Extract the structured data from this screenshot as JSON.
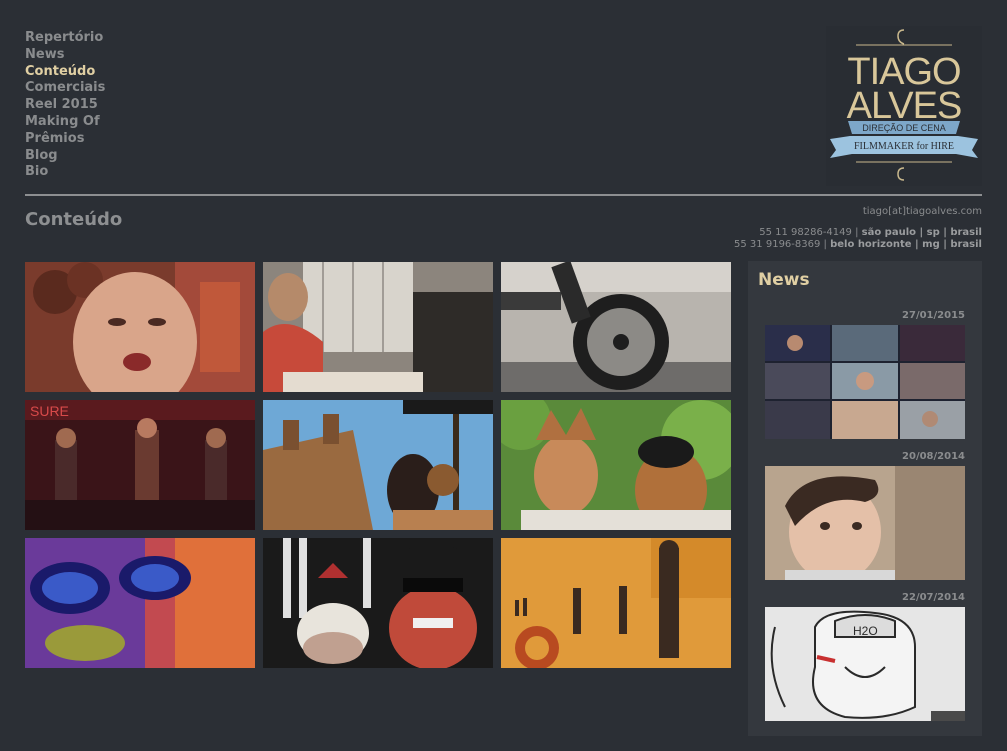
{
  "nav": {
    "items": [
      {
        "label": "Repertório",
        "active": false
      },
      {
        "label": "News",
        "active": false
      },
      {
        "label": "Conteúdo",
        "active": true
      },
      {
        "label": "Comerciais",
        "active": false
      },
      {
        "label": "Reel 2015",
        "active": false
      },
      {
        "label": "Making Of",
        "active": false
      },
      {
        "label": "Prêmios",
        "active": false
      },
      {
        "label": "Blog",
        "active": false
      },
      {
        "label": "Bio",
        "active": false
      }
    ]
  },
  "logo": {
    "line1": "TIAGO",
    "line2": "ALVES",
    "ribbon": "DIREÇÃO DE CENA",
    "tagline": "FILMMAKER for HIRE"
  },
  "page": {
    "title": "Conteúdo"
  },
  "contact": {
    "email": "tiago[at]tiagoalves.com",
    "phone1": "55 11 98286-4149",
    "place1": "são paulo | sp | brasil",
    "phone2": "55 31 9196-8369",
    "place2": "belo horizonte | mg | brasil",
    "sep": " | "
  },
  "news": {
    "title": "News",
    "entries": [
      {
        "date": "27/01/2015"
      },
      {
        "date": "20/08/2014"
      },
      {
        "date": "22/07/2014"
      }
    ]
  },
  "colors": {
    "background": "#2b2f35",
    "accent": "#e0cfa3",
    "text_muted": "#8a8c8e",
    "panel": "#34383e"
  }
}
